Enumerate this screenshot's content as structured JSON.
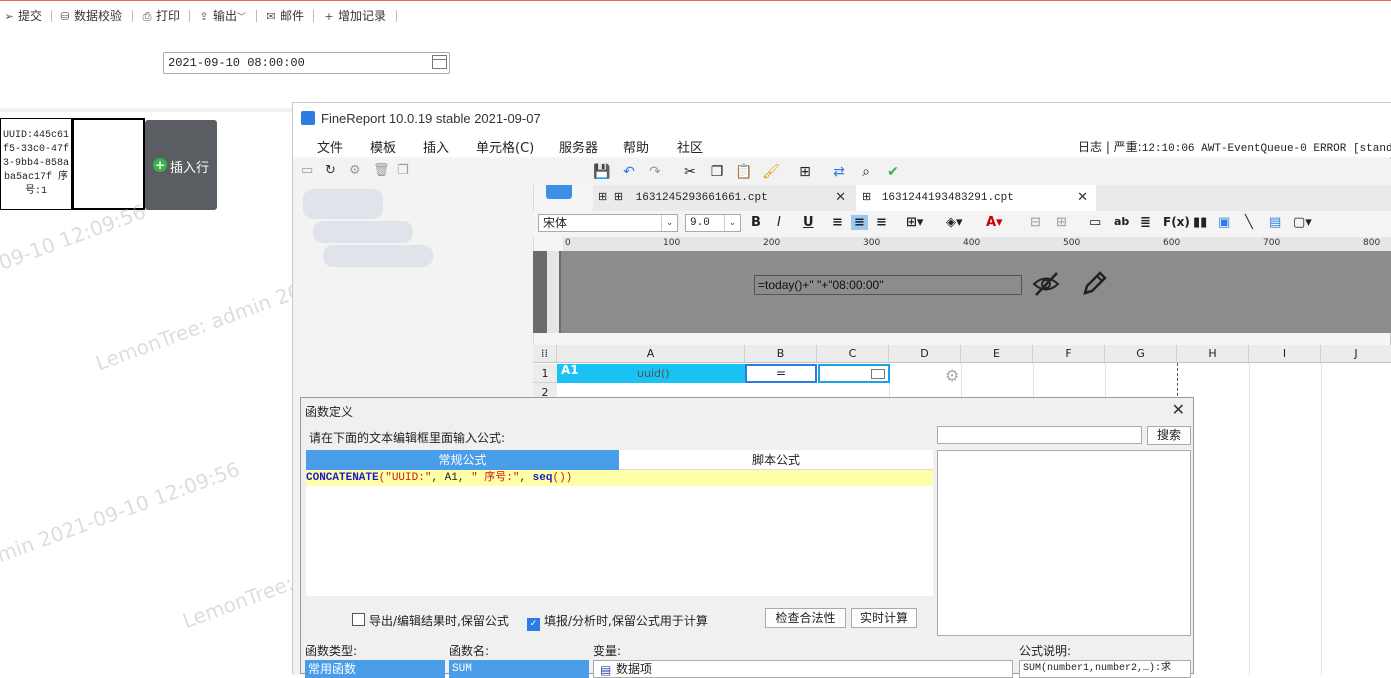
{
  "toolbar": {
    "items": [
      {
        "icon": "send-icon",
        "label": "提交"
      },
      {
        "icon": "database-check-icon",
        "label": "数据校验"
      },
      {
        "icon": "printer-icon",
        "label": "打印"
      },
      {
        "icon": "export-icon",
        "label": "输出"
      },
      {
        "icon": "mail-icon",
        "label": "邮件"
      },
      {
        "icon": "plus-icon",
        "label": "增加记录"
      }
    ]
  },
  "date_field": {
    "value": "2021-09-10 08:00:00"
  },
  "preview_cell": {
    "text": "UUID:445c61f5-33c0-47f3-9bb4-858aba5ac17f 序号:1"
  },
  "insert_row": {
    "label": "插入行"
  },
  "watermarks": [
    "09-10 12:09:56",
    "LemonTree: admin 20",
    "min 2021-09-10 12:09:56",
    "LemonTree:"
  ],
  "app": {
    "title": "FineReport 10.0.19 stable 2021-09-07",
    "menu": [
      "文件",
      "模板",
      "插入",
      "单元格(C)",
      "服务器",
      "帮助",
      "社区"
    ],
    "log_prefix": "日志 | 严重:",
    "log_message": "12:10:06 AWT-EventQueue-0 ERROR [standard",
    "tabs": [
      {
        "label": "1631245293661661.cpt"
      },
      {
        "label": "1631244193483291.cpt"
      }
    ],
    "font_name": "宋体",
    "font_size": "9.0",
    "ruler_marks": [
      "0",
      "100",
      "200",
      "300",
      "400",
      "500",
      "600",
      "700",
      "800"
    ],
    "design_formula": "=today()+\" \"+\"08:00:00\"",
    "columns": [
      "A",
      "B",
      "C",
      "D",
      "E",
      "F",
      "G",
      "H",
      "I",
      "J"
    ],
    "rows": [
      "1",
      "2"
    ],
    "a1_tag": "A1",
    "a1_value": "uuid()",
    "b1_value": "="
  },
  "dialog": {
    "title": "函数定义",
    "prompt": "请在下面的文本编辑框里面输入公式:",
    "search_label": "搜索",
    "tab_regular": "常规公式",
    "tab_script": "脚本公式",
    "formula": {
      "fn": "CONCATENATE",
      "p1": "(",
      "s1": "\"UUID:\"",
      "mid": ", A1, ",
      "s2": "\" 序号:\"",
      "sep": ", ",
      "fn2": "seq",
      "end": "())"
    },
    "keep_formula_export": "导出/编辑结果时,保留公式",
    "keep_formula_fill": "填报/分析时,保留公式用于计算",
    "check_btn": "检查合法性",
    "realtime_btn": "实时计算",
    "fn_type_label": "函数类型:",
    "fn_name_label": "函数名:",
    "var_label": "变量:",
    "desc_label": "公式说明:",
    "fn_type_selected": "常用函数",
    "fn_name_selected": "SUM",
    "var_item": "数据项",
    "desc_text": "SUM(number1,number2,…):求"
  }
}
